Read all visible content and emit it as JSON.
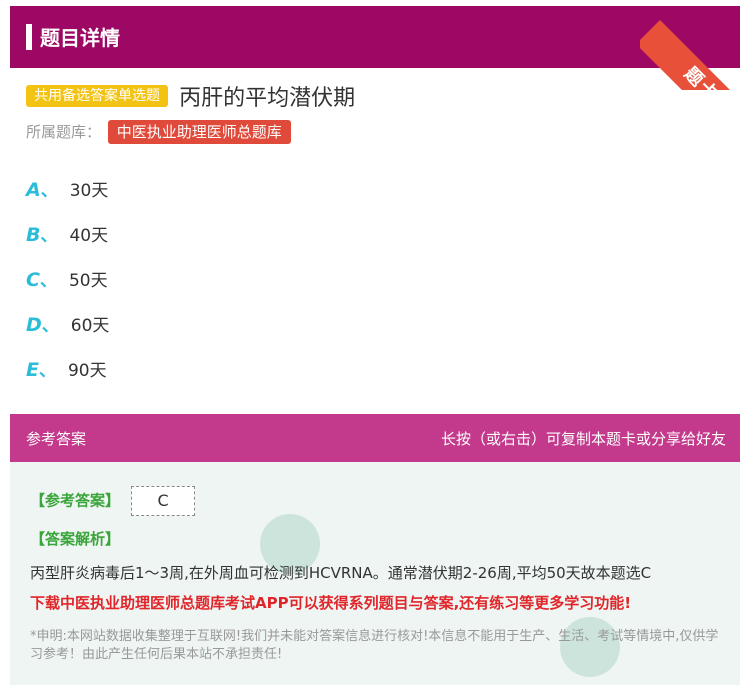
{
  "header": {
    "title": "题目详情",
    "ribbon": "题卡"
  },
  "question": {
    "type_badge": "共用备选答案单选题",
    "title": "丙肝的平均潜伏期",
    "bank_label": "所属题库：",
    "bank_name": "中医执业助理医师总题库"
  },
  "options": [
    {
      "letter": "A",
      "sep": "、",
      "text": "30天"
    },
    {
      "letter": "B",
      "sep": "、",
      "text": "40天"
    },
    {
      "letter": "C",
      "sep": "、",
      "text": "50天"
    },
    {
      "letter": "D",
      "sep": "、",
      "text": "60天"
    },
    {
      "letter": "E",
      "sep": "、",
      "text": "90天"
    }
  ],
  "answer": {
    "section_label": "参考答案",
    "share_hint": "长按（或右击）可复制本题卡或分享给好友",
    "ref_label": "【参考答案】",
    "ref_value": "C",
    "analysis_label": "【答案解析】",
    "analysis_text": "丙型肝炎病毒后1～3周,在外周血可检测到HCVRNA。通常潜伏期2-26周,平均50天故本题选C",
    "promo": "下载中医执业助理医师总题库考试APP可以获得系列题目与答案,还有练习等更多学习功能!",
    "disclaimer": "*申明:本网站数据收集整理于互联网!我们并未能对答案信息进行核对!本信息不能用于生产、生活、考试等情境中,仅供学习参考！由此产生任何后果本站不承担责任!"
  },
  "colors": {
    "header_bg": "#9c0863",
    "answer_header_bg": "#c3398c",
    "badge_yellow": "#f3c313",
    "badge_red": "#e04a3a",
    "option_letter": "#2bbdd8",
    "answer_green": "#3aa53a",
    "promo_red": "#e0262b"
  }
}
